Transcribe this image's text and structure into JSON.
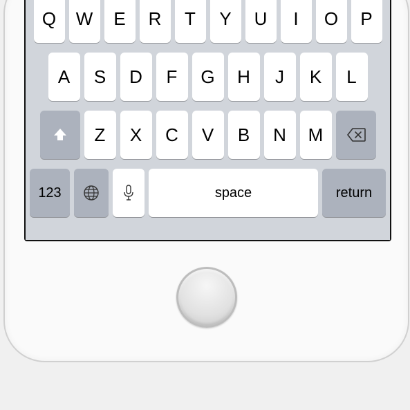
{
  "keyboard": {
    "row1": [
      "Q",
      "W",
      "E",
      "R",
      "T",
      "Y",
      "U",
      "I",
      "O",
      "P"
    ],
    "row2": [
      "A",
      "S",
      "D",
      "F",
      "G",
      "H",
      "J",
      "K",
      "L"
    ],
    "row3": [
      "Z",
      "X",
      "C",
      "V",
      "B",
      "N",
      "M"
    ],
    "numeric_label": "123",
    "space_label": "space",
    "return_label": "return",
    "icons": {
      "shift": "shift-icon",
      "backspace": "backspace-icon",
      "globe": "globe-icon",
      "mic": "mic-icon"
    }
  }
}
